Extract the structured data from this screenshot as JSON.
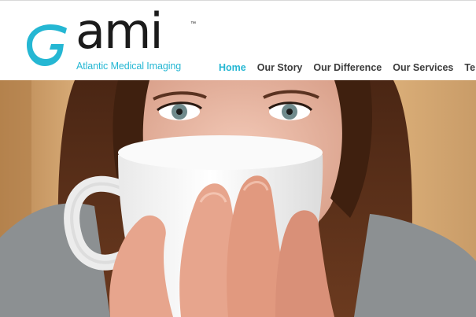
{
  "brand": {
    "wordmark": "ami",
    "trademark": "™",
    "tagline": "Atlantic Medical Imaging",
    "accent_color": "#25b7d3",
    "text_color": "#1b1b1b",
    "icon": "ami-swirl-logo-icon"
  },
  "nav": {
    "items": [
      {
        "label": "Home",
        "active": true
      },
      {
        "label": "Our Story",
        "active": false
      },
      {
        "label": "Our Difference",
        "active": false
      },
      {
        "label": "Our Services",
        "active": false
      },
      {
        "label": "Te",
        "active": false
      }
    ]
  },
  "hero": {
    "image": "woman-drinking-from-white-cup-photo"
  }
}
